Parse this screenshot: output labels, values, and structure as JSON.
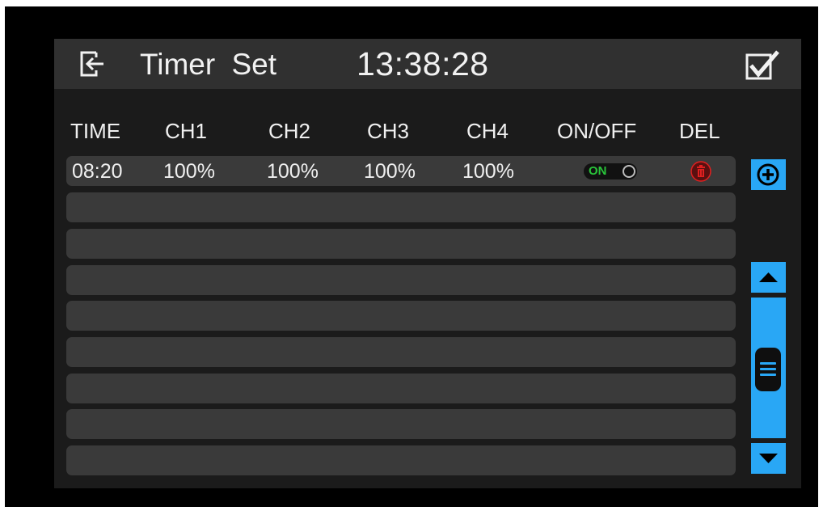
{
  "header": {
    "exit_icon": "exit-icon",
    "title": "Timer Set",
    "clock": "13:38:28",
    "confirm_icon": "checkbox-check-icon"
  },
  "columns": [
    "TIME",
    "CH1",
    "CH2",
    "CH3",
    "CH4",
    "ON/OFF",
    "DEL"
  ],
  "rows": [
    {
      "time": "08:20",
      "ch1": "100%",
      "ch2": "100%",
      "ch3": "100%",
      "ch4": "100%",
      "toggle_label": "ON",
      "toggle_state": "on",
      "delete_icon": "trash-icon"
    },
    {},
    {},
    {},
    {},
    {},
    {},
    {},
    {}
  ],
  "side_controls": {
    "add_icon": "plus-circle-icon",
    "scroll_up_icon": "triangle-up-icon",
    "scroll_down_icon": "triangle-down-icon",
    "scroll_thumb_icon": "menu-lines-icon"
  },
  "colors": {
    "accent": "#29a7f5",
    "toggle_on": "#29c43a",
    "delete": "#e02020",
    "row_bg": "#3a3a3a",
    "title_bg": "#303030"
  }
}
